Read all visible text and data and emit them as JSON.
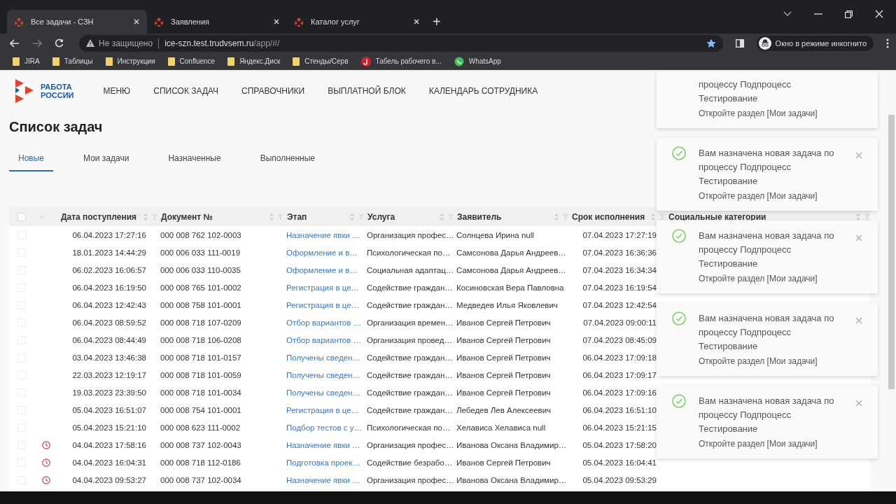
{
  "browser": {
    "tabs": [
      {
        "title": "Все задачи - СЗН",
        "selected": true
      },
      {
        "title": "Заявления",
        "selected": false
      },
      {
        "title": "Каталог услуг",
        "selected": false
      }
    ],
    "new_tab": "+",
    "address": {
      "security": "Не защищено",
      "host": "ice-szn.test.trudvsem.ru",
      "path": "/app/#/"
    },
    "profile": "Окно в режиме инкогнито",
    "bookmarks": [
      {
        "label": "JIRA",
        "kind": "folder"
      },
      {
        "label": "Таблицы",
        "kind": "folder"
      },
      {
        "label": "Инструкции",
        "kind": "folder"
      },
      {
        "label": "Confluence",
        "kind": "folder"
      },
      {
        "label": "Яндекс.Диск",
        "kind": "folder"
      },
      {
        "label": "Стенды/Серв",
        "kind": "folder"
      },
      {
        "label": "Табель рабочего в...",
        "kind": "letter"
      },
      {
        "label": "WhatsApp",
        "kind": "chat"
      }
    ]
  },
  "app": {
    "logo": {
      "line1": "РАБОТА",
      "line2": "РОССИИ"
    },
    "nav": [
      "МЕНЮ",
      "СПИСОК ЗАДАЧ",
      "СПРАВОЧНИКИ",
      "ВЫПЛАТНОЙ БЛОК",
      "КАЛЕНДАРЬ СОТРУДНИКА"
    ],
    "title": "Список задач",
    "tabs": [
      {
        "label": "Новые",
        "selected": true
      },
      {
        "label": "Мои задачи",
        "selected": false
      },
      {
        "label": "Назначенные",
        "selected": false
      },
      {
        "label": "Выполненные",
        "selected": false
      }
    ],
    "table": {
      "all_checked": false,
      "columns": [
        "Дата поступления",
        "Документ №",
        "Этап",
        "Услуга",
        "Заявитель",
        "Срок исполнения",
        "Социальные категории"
      ],
      "rows": [
        {
          "checked": false,
          "overdue": false,
          "cells": [
            "06.04.2023 17:27:16",
            "000 008 762 102-0003",
            "Назначение явки …",
            "Организация профес…",
            "Солнцева Ирина null",
            "07.04.2023 17:27:19"
          ]
        },
        {
          "checked": false,
          "overdue": false,
          "cells": [
            "18.01.2023 14:44:29",
            "000 006 033 111-0019",
            "Оформление и в…",
            "Психологическая по…",
            "Самсонова Дарья Андреев…",
            "07.04.2023 16:36:36"
          ]
        },
        {
          "checked": false,
          "overdue": false,
          "cells": [
            "06.02.2023 16:06:57",
            "000 006 033 110-0035",
            "Оформление и в…",
            "Социальная адаптац…",
            "Самсонова Дарья Андреев…",
            "07.04.2023 16:34:34"
          ]
        },
        {
          "checked": false,
          "overdue": false,
          "cells": [
            "06.04.2023 16:19:50",
            "000 008 765 101-0002",
            "Регистрация в це…",
            "Содействие граждан…",
            "Косиновская Вера Павловна",
            "07.04.2023 16:19:54"
          ]
        },
        {
          "checked": false,
          "overdue": false,
          "cells": [
            "06.04.2023 12:42:43",
            "000 008 758 101-0001",
            "Регистрация в це…",
            "Содействие граждан…",
            "Медведев Илья Яковлевич",
            "07.04.2023 12:42:54"
          ]
        },
        {
          "checked": false,
          "overdue": false,
          "cells": [
            "06.04.2023 08:59:52",
            "000 008 718 107-0209",
            "Отбор вариантов …",
            "Организация времен…",
            "Иванов Сергей Петрович",
            "07.04.2023 09:00:11"
          ]
        },
        {
          "checked": false,
          "overdue": false,
          "cells": [
            "06.04.2023 08:44:49",
            "000 008 718 106-0208",
            "Отбор вариантов …",
            "Организация провед…",
            "Иванов Сергей Петрович",
            "07.04.2023 08:45:09"
          ]
        },
        {
          "checked": false,
          "overdue": false,
          "cells": [
            "03.04.2023 13:46:38",
            "000 008 718 101-0157",
            "Получены сведен…",
            "Содействие граждан…",
            "Иванов Сергей Петрович",
            "06.04.2023 17:09:18"
          ]
        },
        {
          "checked": false,
          "overdue": false,
          "cells": [
            "22.03.2023 12:19:17",
            "000 008 718 101-0059",
            "Получены сведен…",
            "Содействие граждан…",
            "Иванов Сергей Петрович",
            "06.04.2023 17:09:17"
          ]
        },
        {
          "checked": false,
          "overdue": false,
          "cells": [
            "19.03.2023 23:39:50",
            "000 008 718 101-0034",
            "Получены сведен…",
            "Содействие граждан…",
            "Иванов Сергей Петрович",
            "06.04.2023 17:09:16"
          ]
        },
        {
          "checked": false,
          "overdue": false,
          "cells": [
            "05.04.2023 16:51:07",
            "000 008 754 101-0001",
            "Регистрация в це…",
            "Содействие граждан…",
            "Лебедев Лев Алексеевич",
            "06.04.2023 16:51:10"
          ]
        },
        {
          "checked": false,
          "overdue": false,
          "cells": [
            "05.04.2023 15:21:10",
            "000 008 623 111-0002",
            "Подбор тестов с у…",
            "Психологическая по…",
            "Хелависа Хелависа null",
            "06.04.2023 15:21:15"
          ]
        },
        {
          "checked": false,
          "overdue": true,
          "cells": [
            "04.04.2023 17:58:16",
            "000 008 737 102-0043",
            "Назначение явки …",
            "Организация профес…",
            "Иванова Оксана Владимир…",
            "05.04.2023 17:58:20"
          ]
        },
        {
          "checked": false,
          "overdue": true,
          "cells": [
            "04.04.2023 16:04:31",
            "000 008 718 112-0186",
            "Подготовка проек…",
            "Содействие безрабо…",
            "Иванов Сергей Петрович",
            "05.04.2023 16:04:41"
          ]
        },
        {
          "checked": false,
          "overdue": true,
          "cells": [
            "04.04.2023 09:53:27",
            "000 008 737 102-0034",
            "Назначение явки …",
            "Организация профес…",
            "Иванова Оксана Владимир…",
            "05.04.2023 09:53:29"
          ]
        }
      ]
    }
  },
  "notifications": [
    {
      "clipped": true,
      "message": "процессу Подпроцесс Тестирование",
      "action": "Откройте раздел [Мои задачи]"
    },
    {
      "clipped": false,
      "message": "Вам назначена новая задача по процессу Подпроцесс Тестирование",
      "action": "Откройте раздел [Мои задачи]"
    },
    {
      "clipped": false,
      "message": "Вам назначена новая задача по процессу Подпроцесс Тестирование",
      "action": "Откройте раздел [Мои задачи]"
    },
    {
      "clipped": false,
      "message": "Вам назначена новая задача по процессу Подпроцесс Тестирование",
      "action": "Откройте раздел [Мои задачи]"
    },
    {
      "clipped": false,
      "message": "Вам назначена новая задача по процессу Подпроцесс Тестирование",
      "action": "Откройте раздел [Мои задачи]"
    }
  ]
}
